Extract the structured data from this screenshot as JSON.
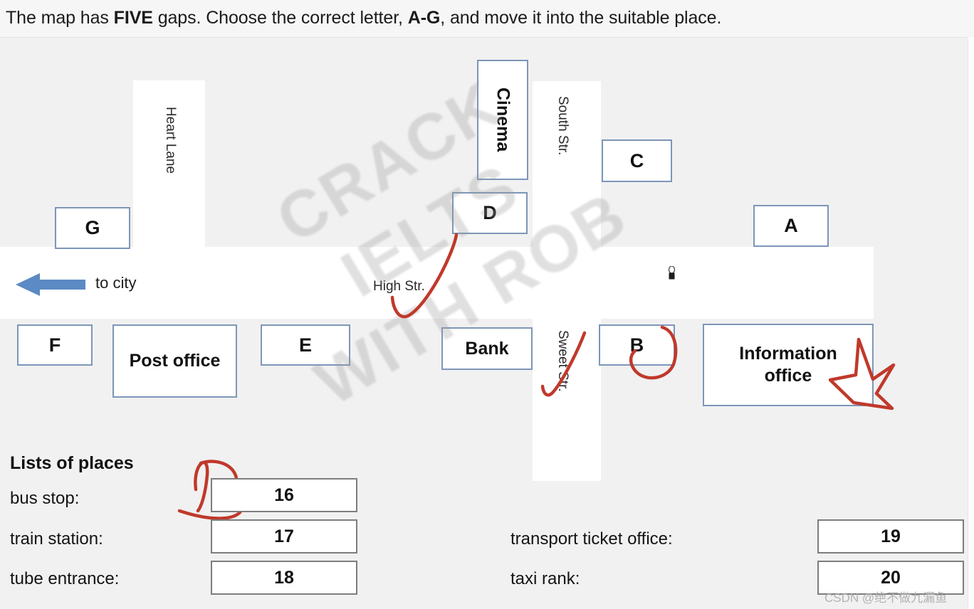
{
  "instruction": {
    "part1": "The map has ",
    "bold1": "FIVE",
    "part2": " gaps. Choose the correct letter, ",
    "bold2": "A-G",
    "part3": ", and move it into the suitable place."
  },
  "map": {
    "roads": [
      {
        "name": "heart-lane",
        "label": "Heart Lane"
      },
      {
        "name": "south-str",
        "label": "South Str."
      },
      {
        "name": "high-str",
        "label": "High Str."
      },
      {
        "name": "sweet-str",
        "label": "Sweet Str."
      }
    ],
    "direction_arrow": {
      "label": "to city",
      "color": "#5b8ac4"
    },
    "letter_boxes": [
      {
        "id": "A",
        "label": "A"
      },
      {
        "id": "B",
        "label": "B"
      },
      {
        "id": "C",
        "label": "C"
      },
      {
        "id": "D",
        "label": "D"
      },
      {
        "id": "E",
        "label": "E"
      },
      {
        "id": "F",
        "label": "F"
      },
      {
        "id": "G",
        "label": "G"
      }
    ],
    "place_boxes": [
      {
        "id": "cinema",
        "label": "Cinema"
      },
      {
        "id": "bank",
        "label": "Bank"
      },
      {
        "id": "post-office",
        "label": "Post office"
      },
      {
        "id": "information-office",
        "label": "Information office"
      }
    ],
    "box_border_color": "#7d96b8"
  },
  "watermark": {
    "line1": "CRACK IELTS",
    "line2": "WITH ROB"
  },
  "annotations": {
    "ink_color": "#c0392b",
    "marks": [
      {
        "name": "check-near-d",
        "type": "check"
      },
      {
        "name": "check-near-sweet-str",
        "type": "check"
      },
      {
        "name": "circle-around-b",
        "type": "circle"
      },
      {
        "name": "star-on-information-office",
        "type": "star"
      },
      {
        "name": "letter-b-handwritten",
        "type": "letter",
        "text": "B"
      }
    ]
  },
  "lists": {
    "title": "Lists of places",
    "left": [
      {
        "label": "bus stop:",
        "value": "16"
      },
      {
        "label": "train station:",
        "value": "17"
      },
      {
        "label": "tube entrance:",
        "value": "18"
      }
    ],
    "right": [
      {
        "label": "transport ticket office:",
        "value": "19"
      },
      {
        "label": "taxi rank:",
        "value": "20"
      }
    ]
  },
  "footer": {
    "csdn_watermark": "CSDN @绝不做九漏鱼"
  }
}
